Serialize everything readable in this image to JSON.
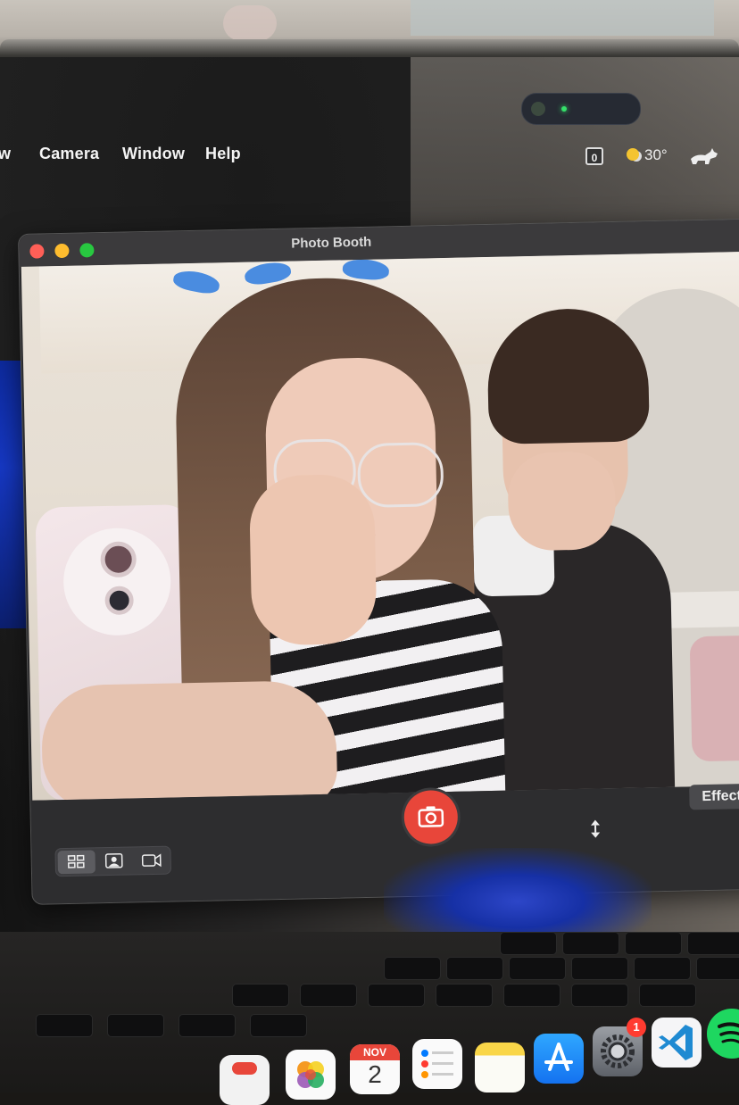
{
  "menubar": {
    "items": [
      "w",
      "Camera",
      "Window",
      "Help"
    ],
    "status_box": "0",
    "temperature": "30°"
  },
  "window": {
    "title": "Photo Booth",
    "effects_label": "Effects"
  },
  "dock": {
    "settings_badge": "1",
    "calendar_month": "NOV",
    "calendar_day": "2"
  },
  "colors": {
    "shutter": "#e8463a",
    "traffic_red": "#ff5f57",
    "traffic_yellow": "#febc2e",
    "traffic_green": "#28c840",
    "camera_led": "#35e06a"
  },
  "icons": {
    "toolbar": [
      "grid-view-icon",
      "portrait-view-icon",
      "video-icon",
      "camera-icon",
      "resize-icon"
    ],
    "dock": [
      "photos-icon",
      "calendar-icon",
      "reminders-icon",
      "notes-icon",
      "app-store-icon",
      "system-settings-icon",
      "vscode-icon",
      "spotify-icon"
    ]
  }
}
